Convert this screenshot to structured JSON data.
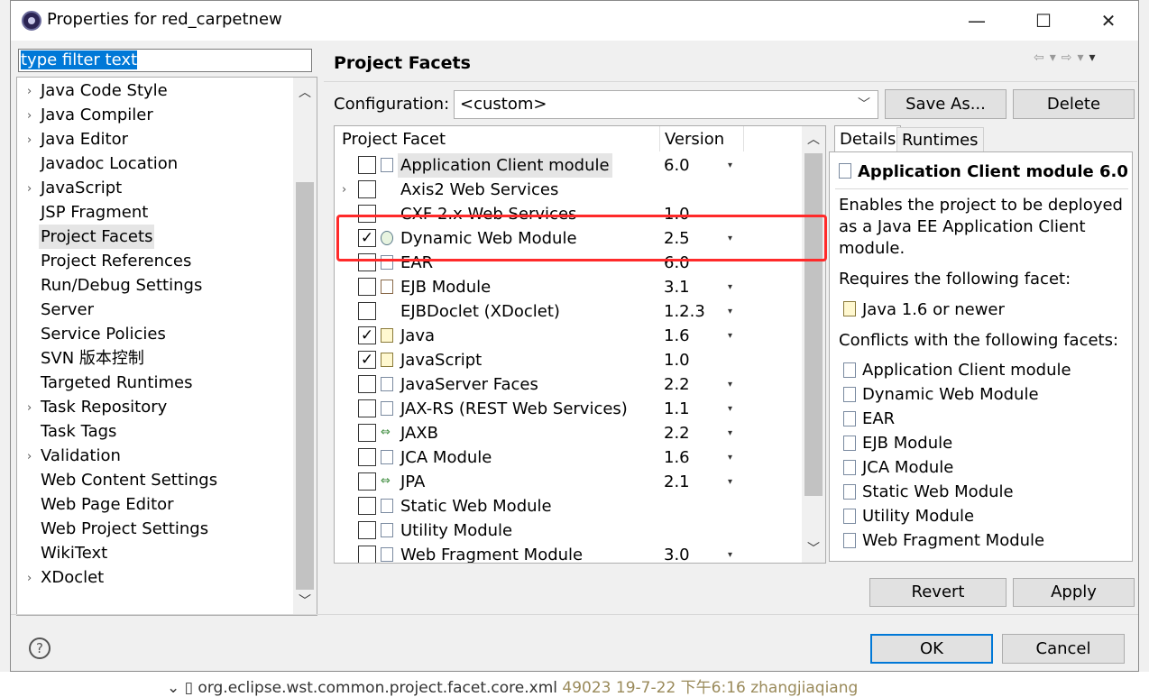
{
  "window": {
    "title": "Properties for red_carpetnew",
    "minimize": "—",
    "maximize": "☐",
    "close": "✕"
  },
  "filter": {
    "text": "type filter text"
  },
  "tree": [
    {
      "label": "Java Code Style",
      "expandable": true
    },
    {
      "label": "Java Compiler",
      "expandable": true
    },
    {
      "label": "Java Editor",
      "expandable": true
    },
    {
      "label": "Javadoc Location",
      "expandable": false
    },
    {
      "label": "JavaScript",
      "expandable": true
    },
    {
      "label": "JSP Fragment",
      "expandable": false
    },
    {
      "label": "Project Facets",
      "expandable": false,
      "selected": true
    },
    {
      "label": "Project References",
      "expandable": false
    },
    {
      "label": "Run/Debug Settings",
      "expandable": false
    },
    {
      "label": "Server",
      "expandable": false
    },
    {
      "label": "Service Policies",
      "expandable": false
    },
    {
      "label": "SVN 版本控制",
      "expandable": false
    },
    {
      "label": "Targeted Runtimes",
      "expandable": false
    },
    {
      "label": "Task Repository",
      "expandable": true
    },
    {
      "label": "Task Tags",
      "expandable": false
    },
    {
      "label": "Validation",
      "expandable": true
    },
    {
      "label": "Web Content Settings",
      "expandable": false
    },
    {
      "label": "Web Page Editor",
      "expandable": false
    },
    {
      "label": "Web Project Settings",
      "expandable": false
    },
    {
      "label": "WikiText",
      "expandable": false
    },
    {
      "label": "XDoclet",
      "expandable": true
    }
  ],
  "page": {
    "title": "Project Facets"
  },
  "configuration": {
    "label": "Configuration:",
    "value": "<custom>",
    "save_as": "Save As...",
    "delete": "Delete"
  },
  "facets": {
    "col_facet": "Project Facet",
    "col_version": "Version",
    "rows": [
      {
        "name": "Application Client module",
        "version": "6.0",
        "checked": false,
        "icon": "page-icon",
        "dropdown": true,
        "highlight": true
      },
      {
        "name": "Axis2 Web Services",
        "version": "",
        "checked": false,
        "icon": "none",
        "expander": true
      },
      {
        "name": "CXF 2.x Web Services",
        "version": "1.0",
        "checked": false,
        "icon": "none"
      },
      {
        "name": "Dynamic Web Module",
        "version": "2.5",
        "checked": true,
        "icon": "web-module-icon",
        "dropdown": true
      },
      {
        "name": "EAR",
        "version": "6.0",
        "checked": false,
        "icon": "page-icon"
      },
      {
        "name": "EJB Module",
        "version": "3.1",
        "checked": false,
        "icon": "ejb-icon",
        "dropdown": true
      },
      {
        "name": "EJBDoclet (XDoclet)",
        "version": "1.2.3",
        "checked": false,
        "icon": "none",
        "dropdown": true
      },
      {
        "name": "Java",
        "version": "1.6",
        "checked": true,
        "icon": "java-icon",
        "dropdown": true
      },
      {
        "name": "JavaScript",
        "version": "1.0",
        "checked": true,
        "icon": "javascript-icon"
      },
      {
        "name": "JavaServer Faces",
        "version": "2.2",
        "checked": false,
        "icon": "page-icon",
        "dropdown": true
      },
      {
        "name": "JAX-RS (REST Web Services)",
        "version": "1.1",
        "checked": false,
        "icon": "page-icon",
        "dropdown": true
      },
      {
        "name": "JAXB",
        "version": "2.2",
        "checked": false,
        "icon": "jaxb-icon",
        "dropdown": true
      },
      {
        "name": "JCA Module",
        "version": "1.6",
        "checked": false,
        "icon": "page-icon",
        "dropdown": true
      },
      {
        "name": "JPA",
        "version": "2.1",
        "checked": false,
        "icon": "jpa-icon",
        "dropdown": true
      },
      {
        "name": "Static Web Module",
        "version": "",
        "checked": false,
        "icon": "page-icon"
      },
      {
        "name": "Utility Module",
        "version": "",
        "checked": false,
        "icon": "page-icon"
      },
      {
        "name": "Web Fragment Module",
        "version": "3.0",
        "checked": false,
        "icon": "page-icon",
        "dropdown": true
      }
    ]
  },
  "tabs": {
    "details": "Details",
    "runtimes": "Runtimes"
  },
  "details": {
    "heading": "Application Client module 6.0",
    "description": [
      "Enables the project to be deployed",
      "as a Java EE Application Client",
      "module."
    ],
    "requires_label": "Requires the following facet:",
    "requires": [
      "Java 1.6 or newer"
    ],
    "conflicts_label": "Conflicts with the following facets:",
    "conflicts": [
      "Application Client module",
      "Dynamic Web Module",
      "EAR",
      "EJB Module",
      "JCA Module",
      "Static Web Module",
      "Utility Module",
      "Web Fragment Module"
    ]
  },
  "buttons": {
    "revert": "Revert",
    "apply": "Apply",
    "ok": "OK",
    "cancel": "Cancel",
    "help": "?"
  },
  "background": {
    "bottom_file": "org.eclipse.wst.common.project.facet.core.xml",
    "bottom_meta": "49023  19-7-22  下午6:16  zhangjiaqiang"
  },
  "colors": {
    "highlight_box": "#ff2a2a",
    "accent": "#0078d7"
  }
}
